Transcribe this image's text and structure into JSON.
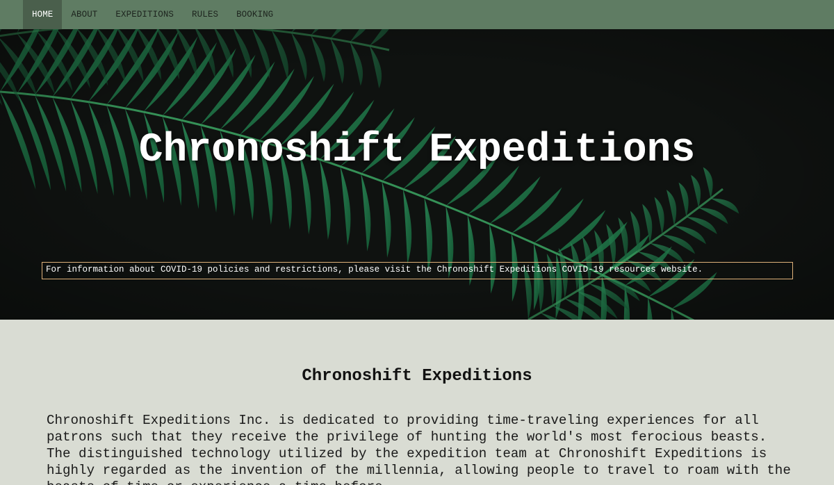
{
  "nav": {
    "items": [
      {
        "label": "HOME",
        "active": true
      },
      {
        "label": "ABOUT",
        "active": false
      },
      {
        "label": "EXPEDITIONS",
        "active": false
      },
      {
        "label": "RULES",
        "active": false
      },
      {
        "label": "BOOKING",
        "active": false
      }
    ]
  },
  "hero": {
    "title": "Chronoshift Expeditions",
    "notice": "For information about COVID-19 policies and restrictions, please visit the Chronoshift Expeditions COVID-19 resources website."
  },
  "main": {
    "heading": "Chronoshift Expeditions",
    "paragraph": "Chronoshift Expeditions Inc. is dedicated to providing time-traveling experiences for all patrons such that they receive the privilege of hunting the world's most ferocious beasts. The distinguished technology utilized by the expedition team at Chronoshift Expeditions is highly regarded as the invention of the millennia, allowing people to travel to roam with the beasts of time or experience a time before"
  },
  "colors": {
    "nav_bg": "#5f7c63",
    "nav_active_bg": "#4a5f4c",
    "hero_bg": "#0f1210",
    "fern": "#1f7a4a",
    "notice_border": "#e0b27a",
    "content_bg": "#d9dcd3"
  }
}
